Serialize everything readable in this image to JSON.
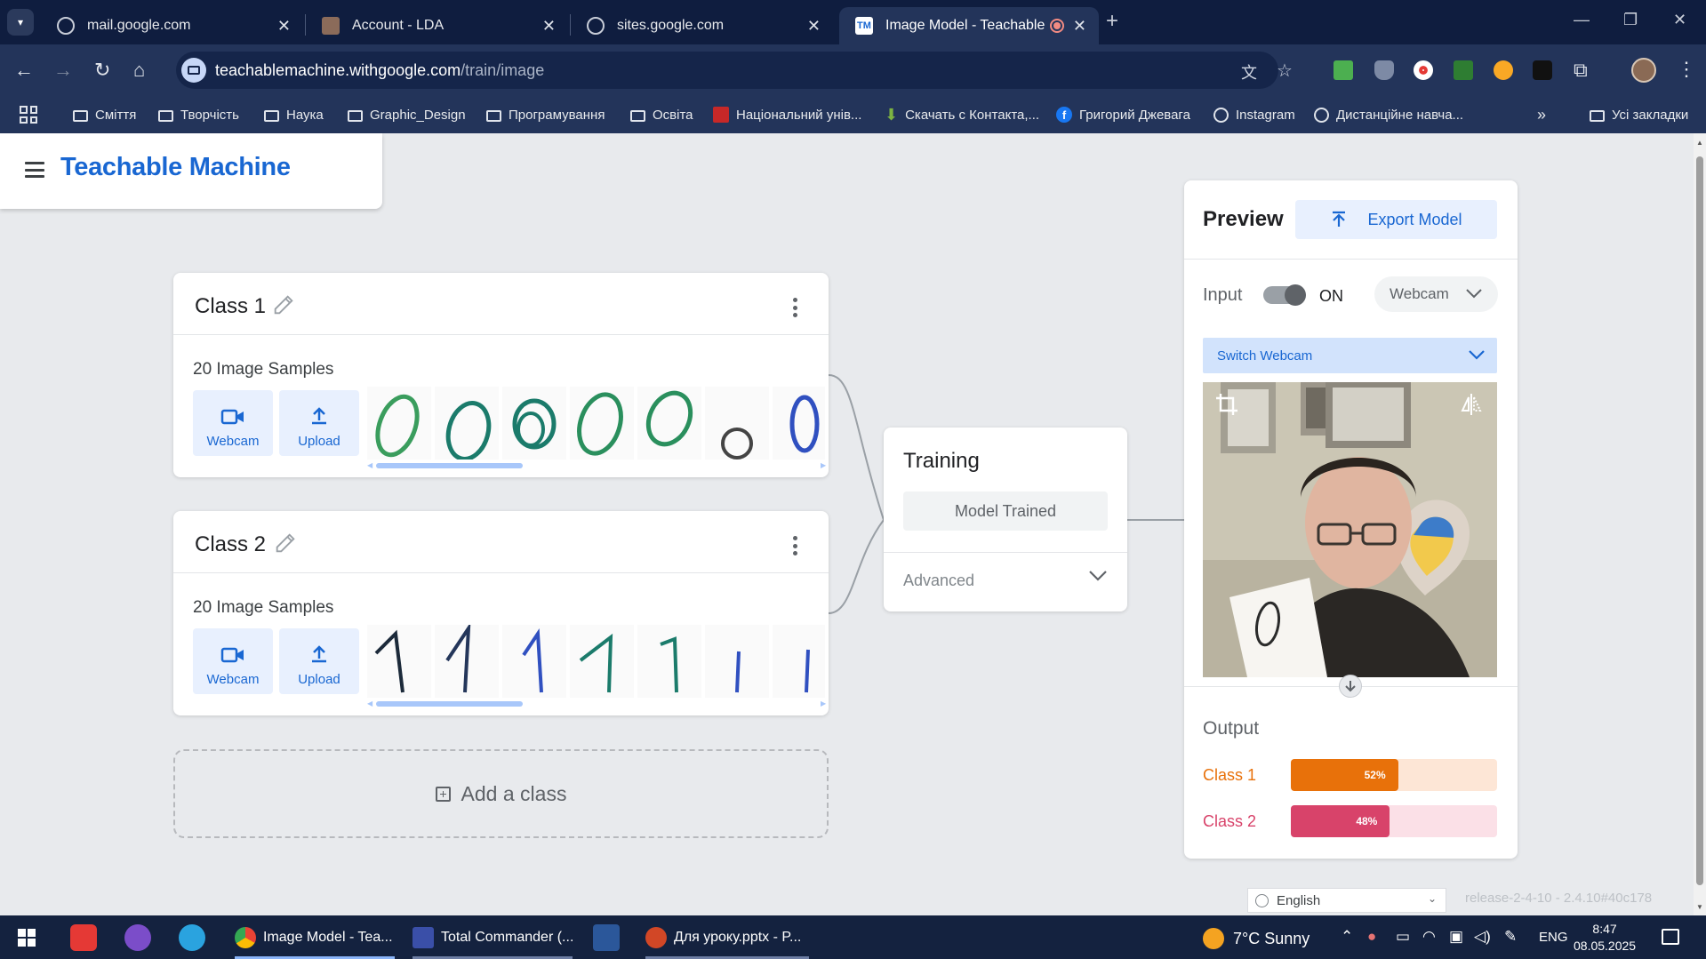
{
  "browser": {
    "tabs": [
      {
        "title": "mail.google.com",
        "active": false
      },
      {
        "title": "Account - LDA",
        "active": false
      },
      {
        "title": "sites.google.com",
        "active": false
      },
      {
        "title": "Image Model - Teachable M",
        "active": true,
        "favicon_text": "TM"
      }
    ],
    "url_host": "teachablemachine.withgoogle.com",
    "url_path": "/train/image",
    "bookmarks": [
      {
        "label": "Сміття",
        "icon": "folder-icon"
      },
      {
        "label": "Творчість",
        "icon": "folder-icon"
      },
      {
        "label": "Наука",
        "icon": "folder-icon"
      },
      {
        "label": "Graphic_Design",
        "icon": "folder-icon"
      },
      {
        "label": "Програмування",
        "icon": "folder-icon"
      },
      {
        "label": "Освіта",
        "icon": "folder-icon"
      },
      {
        "label": "Національний унів...",
        "icon": "site-icon"
      },
      {
        "label": "Скачать с Контакта,...",
        "icon": "download-icon"
      },
      {
        "label": "Григорий Джевага",
        "icon": "facebook-icon"
      },
      {
        "label": "Instagram",
        "icon": "globe-icon"
      },
      {
        "label": "Дистанційне навча...",
        "icon": "globe-icon"
      }
    ],
    "all_bookmarks_label": "Усі закладки",
    "colors": {
      "chrome_dark": "#0f1d3f",
      "chrome_toolbar": "#23345a"
    }
  },
  "app": {
    "brand": "Teachable Machine",
    "brand_color": "#1967d2"
  },
  "classes": [
    {
      "name": "Class 1",
      "samples_label": "20 Image Samples",
      "webcam_label": "Webcam",
      "upload_label": "Upload",
      "sample_glyphs": [
        "0",
        "0",
        "0",
        "0",
        "0",
        "0",
        "0"
      ]
    },
    {
      "name": "Class 2",
      "samples_label": "20 Image Samples",
      "webcam_label": "Webcam",
      "upload_label": "Upload",
      "sample_glyphs": [
        "1",
        "1",
        "1",
        "1",
        "1",
        "1",
        "1"
      ]
    }
  ],
  "add_class_label": "Add a class",
  "training": {
    "title": "Training",
    "button_label": "Model Trained",
    "advanced_label": "Advanced"
  },
  "preview": {
    "title": "Preview",
    "export_label": "Export Model",
    "input_label": "Input",
    "toggle_state": "ON",
    "source_label": "Webcam",
    "switch_label": "Switch Webcam",
    "output_label": "Output",
    "outputs": [
      {
        "name": "Class 1",
        "percent": 52,
        "label": "52%",
        "color": "#e8710a",
        "track_color": "#fde6d6"
      },
      {
        "name": "Class 2",
        "percent": 48,
        "label": "48%",
        "color": "#d8436a",
        "track_color": "#fbe0e7"
      }
    ]
  },
  "footer": {
    "language": "English",
    "release": "release-2-4-10 - 2.4.10#40c178"
  },
  "taskbar": {
    "apps": [
      {
        "label": "Image Model - Tea...",
        "active": true
      },
      {
        "label": "Total Commander (...",
        "active": false
      },
      {
        "label": "Для уроку.pptx - P...",
        "active": false
      }
    ],
    "weather": "7°C  Sunny",
    "language": "ENG",
    "time": "8:47",
    "date": "08.05.2025"
  }
}
